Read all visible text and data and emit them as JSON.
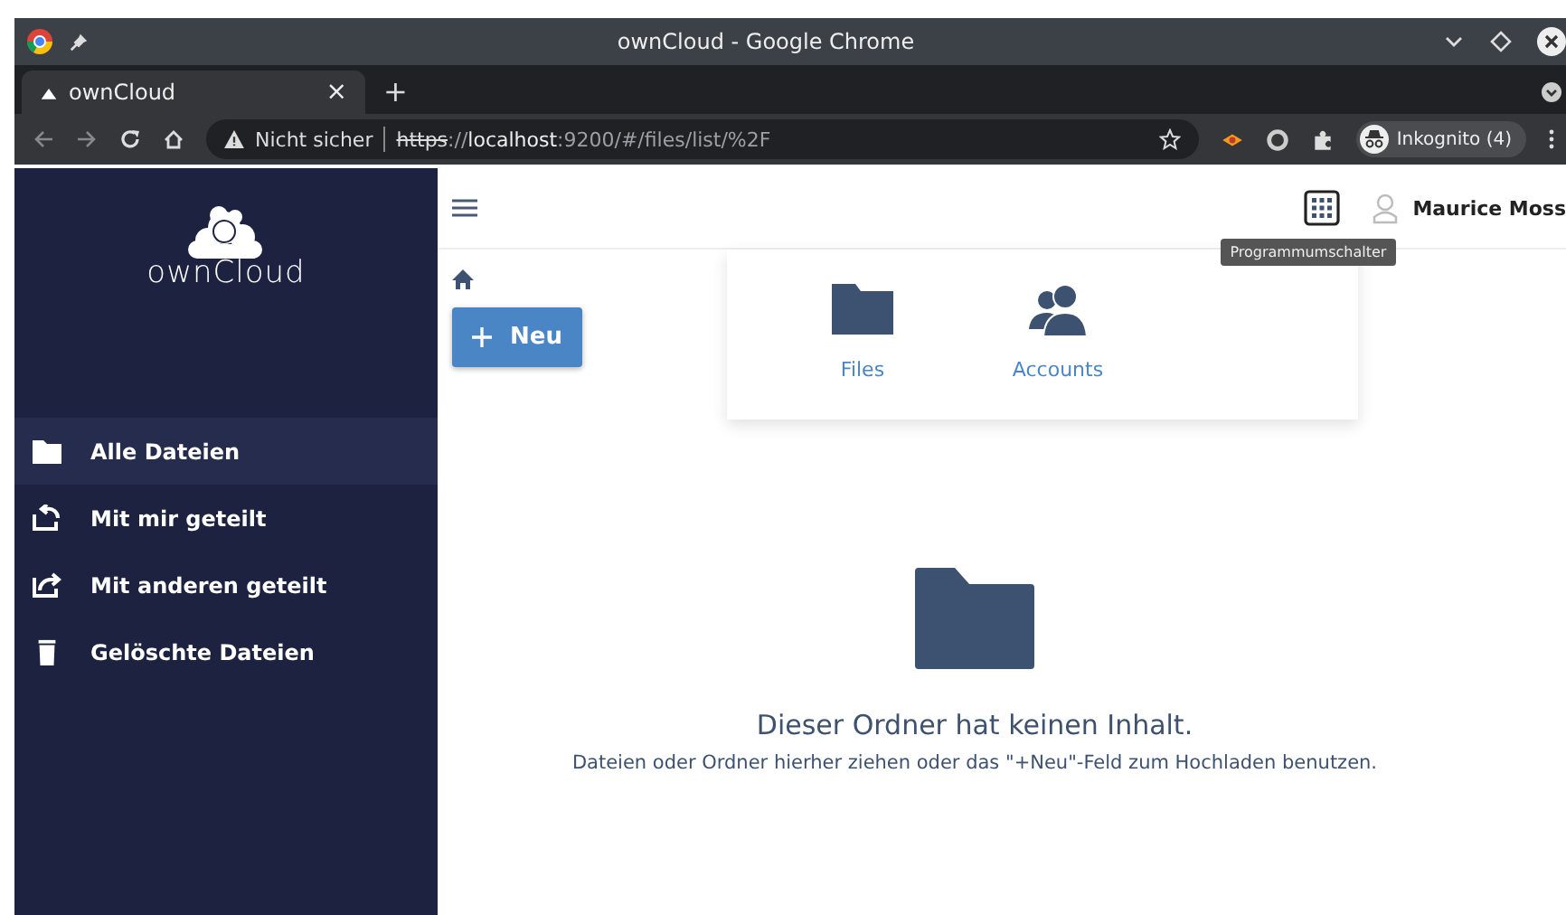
{
  "window": {
    "title": "ownCloud - Google Chrome"
  },
  "tabs": [
    {
      "label": "ownCloud",
      "close": "×",
      "selected": true
    }
  ],
  "new_tab": "+",
  "address_bar": {
    "security": "Nicht sicher",
    "url_scheme": "https",
    "url_sep": "://",
    "url_host": "localhost",
    "url_rest": ":9200/#/files/list/%2F"
  },
  "profile": {
    "label": "Inkognito (4)"
  },
  "sidebar": {
    "logo": "ownCloud",
    "items": [
      {
        "label": "Alle Dateien",
        "kind": "folder",
        "selected": true
      },
      {
        "label": "Mit mir geteilt",
        "kind": "shared-in",
        "selected": false
      },
      {
        "label": "Mit anderen geteilt",
        "kind": "shared-out",
        "selected": false
      },
      {
        "label": "Gelöschte Dateien",
        "kind": "trash",
        "selected": false
      }
    ]
  },
  "topbar": {
    "user": "Maurice Moss",
    "tooltip": "Programmumschalter"
  },
  "new_button": {
    "label": "Neu"
  },
  "app_switcher": [
    {
      "label": "Files",
      "kind": "folder"
    },
    {
      "label": "Accounts",
      "kind": "users"
    }
  ],
  "empty_state": {
    "title": "Dieser Ordner hat keinen Inhalt.",
    "hint": "Dateien oder Ordner hierher ziehen oder das \"+Neu\"-Feld zum Hochladen benutzen."
  }
}
